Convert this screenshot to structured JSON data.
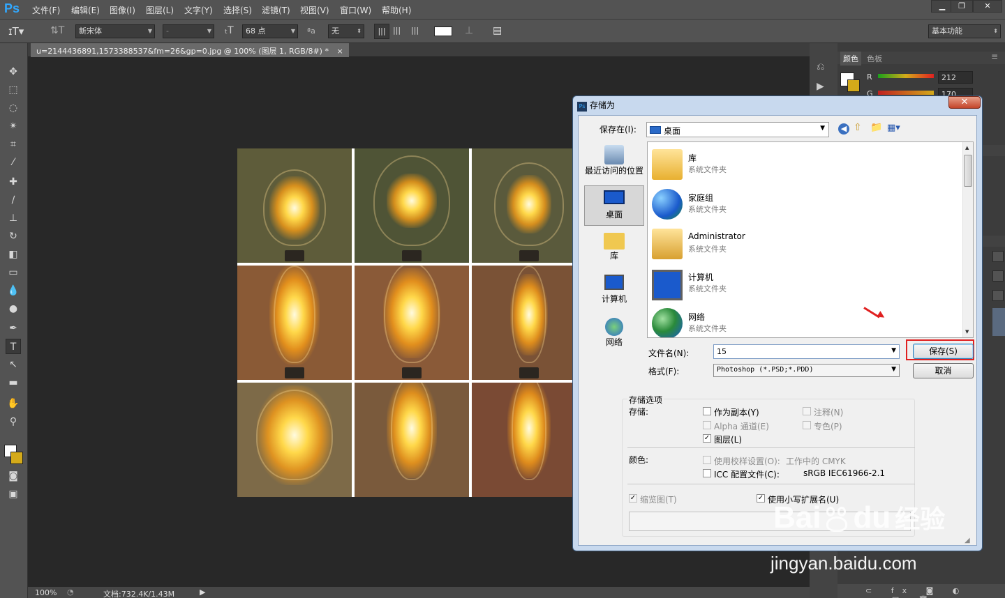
{
  "app": {
    "logo": "Ps"
  },
  "menubar": {
    "items": [
      "文件(F)",
      "编辑(E)",
      "图像(I)",
      "图层(L)",
      "文字(Y)",
      "选择(S)",
      "滤镜(T)",
      "视图(V)",
      "窗口(W)",
      "帮助(H)"
    ]
  },
  "options": {
    "font_family": "新宋体",
    "font_style": "-",
    "font_size": "68 点",
    "aa_label": "ªa",
    "anti_alias": "无",
    "workspace": "基本功能"
  },
  "document": {
    "tab_title": "u=2144436891,1573388537&fm=26&gp=0.jpg @ 100% (图层 1, RGB/8#) *",
    "close": "×"
  },
  "statusbar": {
    "zoom": "100%",
    "doc_info": "文档:732.4K/1.43M"
  },
  "color_panel": {
    "tabs": [
      "颜色",
      "色板"
    ],
    "channel_r": "R",
    "r_value": "212",
    "channel_g": "G",
    "g_value": "170"
  },
  "dialog": {
    "title": "存储为",
    "save_in_label": "保存在(I):",
    "save_in_value": "桌面",
    "places": [
      "最近访问的位置",
      "桌面",
      "库",
      "计算机",
      "网络"
    ],
    "files": [
      {
        "name": "库",
        "type": "系统文件夹"
      },
      {
        "name": "家庭组",
        "type": "系统文件夹"
      },
      {
        "name": "Administrator",
        "type": "系统文件夹"
      },
      {
        "name": "计算机",
        "type": "系统文件夹"
      },
      {
        "name": "网络",
        "type": "系统文件夹"
      }
    ],
    "filename_label": "文件名(N):",
    "filename_value": "15",
    "format_label": "格式(F):",
    "format_value": "Photoshop (*.PSD;*.PDD)",
    "save_button": "保存(S)",
    "cancel_button": "取消",
    "options_title": "存储选项",
    "save_group": "存储:",
    "as_copy": "作为副本(Y)",
    "notes": "注释(N)",
    "alpha": "Alpha 通道(E)",
    "spot": "专色(P)",
    "layers": "图层(L)",
    "color_group": "颜色:",
    "proof": "使用校样设置(O):",
    "proof_value": "工作中的 CMYK",
    "icc": "ICC 配置文件(C):",
    "icc_value": "sRGB IEC61966-2.1",
    "thumbnail": "缩览图(T)",
    "lowercase_ext": "使用小写扩展名(U)",
    "checks": {
      "as_copy": false,
      "notes": false,
      "alpha": false,
      "spot": false,
      "layers": true,
      "proof": false,
      "icc": false,
      "thumbnail": true,
      "lowercase_ext": true
    }
  },
  "watermark": {
    "brand": "Bai",
    "brand2": "du",
    "brand_cn": "经验",
    "domain": "jingyan.baidu.com"
  },
  "colors": {
    "ui_gray": "#535353",
    "canvas_bg": "#282828",
    "highlight": "#e02020",
    "ps_blue": "#31a8ff",
    "fg_color": "#ffffff",
    "bg_color": "#d4aa1a"
  }
}
